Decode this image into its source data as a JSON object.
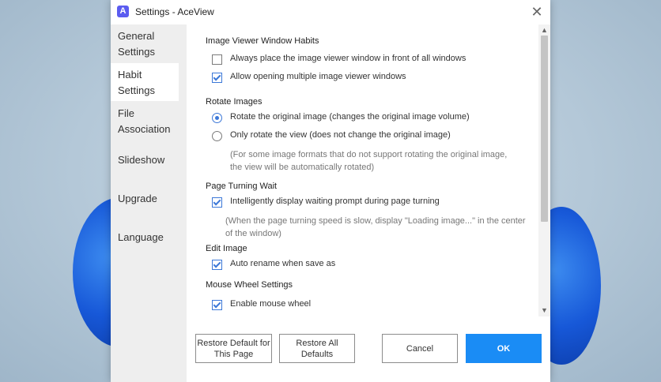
{
  "window": {
    "title": "Settings - AceView",
    "logo_letter": "A",
    "close_glyph": "✕"
  },
  "sidebar": {
    "items": [
      {
        "label": "General Settings",
        "active": false
      },
      {
        "label": "Habit Settings",
        "active": true
      },
      {
        "label": "File Association",
        "active": false
      },
      {
        "label": "Slideshow",
        "active": false
      },
      {
        "label": "Upgrade",
        "active": false
      },
      {
        "label": "Language",
        "active": false
      }
    ]
  },
  "sections": {
    "viewer_window": {
      "title": "Image Viewer Window Habits",
      "always_front": {
        "label": "Always place the image viewer window in front of all windows",
        "checked": false
      },
      "multiple_windows": {
        "label": "Allow opening multiple image viewer windows",
        "checked": true
      }
    },
    "rotate": {
      "title": "Rotate Images",
      "rotate_original": {
        "label": "Rotate the original image (changes the original image volume)",
        "selected": true
      },
      "rotate_view": {
        "label": "Only rotate the view (does not change the original image)",
        "selected": false
      },
      "note_line1": "(For some image formats that do not support rotating the original image,",
      "note_line2": "the view will be automatically rotated)"
    },
    "page_turning": {
      "title": "Page Turning Wait",
      "smart_prompt": {
        "label": "Intelligently display waiting prompt during page turning",
        "checked": true
      },
      "note_line1": "(When the page turning speed is slow, display \"Loading image...\" in the center",
      "note_line2": "of the window)"
    },
    "edit_image": {
      "title": "Edit Image",
      "auto_rename": {
        "label": "Auto rename when save as",
        "checked": true
      }
    },
    "mouse_wheel": {
      "title": "Mouse Wheel Settings",
      "enable_wheel": {
        "label": "Enable mouse wheel",
        "checked": true
      }
    }
  },
  "scrollbar": {
    "up_glyph": "▲",
    "down_glyph": "▼"
  },
  "buttons": {
    "restore_page": "Restore Default for This Page",
    "restore_all": "Restore All Defaults",
    "cancel": "Cancel",
    "ok": "OK"
  },
  "colors": {
    "accent": "#1a8cf5",
    "check": "#3c78d8",
    "sidebar_bg": "#eeeeee"
  }
}
